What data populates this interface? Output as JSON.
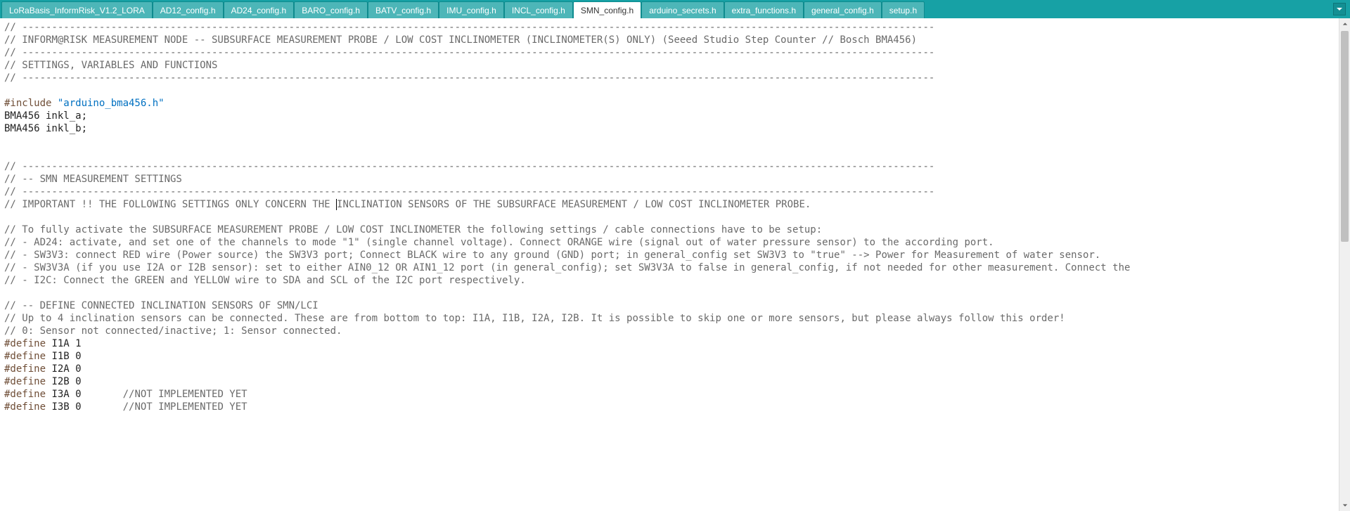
{
  "tabs": [
    {
      "label": "LoRaBasis_InformRisk_V1.2_LORA"
    },
    {
      "label": "AD12_config.h"
    },
    {
      "label": "AD24_config.h"
    },
    {
      "label": "BARO_config.h"
    },
    {
      "label": "BATV_config.h"
    },
    {
      "label": "IMU_config.h"
    },
    {
      "label": "INCL_config.h"
    },
    {
      "label": "SMN_config.h"
    },
    {
      "label": "arduino_secrets.h"
    },
    {
      "label": "extra_functions.h"
    },
    {
      "label": "general_config.h"
    },
    {
      "label": "setup.h"
    }
  ],
  "active_tab_index": 7,
  "icons": {
    "dropdown": "chevron-down-icon",
    "scroll_up": "scroll-up-icon",
    "scroll_down": "scroll-down-icon"
  },
  "code": {
    "l1": "// ----------------------------------------------------------------------------------------------------------------------------------------------------------",
    "l2": "// INFORM@RISK MEASUREMENT NODE -- SUBSURFACE MEASUREMENT PROBE / LOW COST INCLINOMETER (INCLINOMETER(S) ONLY) (Seeed Studio Step Counter // Bosch BMA456)",
    "l3": "// ----------------------------------------------------------------------------------------------------------------------------------------------------------",
    "l4": "// SETTINGS, VARIABLES AND FUNCTIONS",
    "l5": "// ----------------------------------------------------------------------------------------------------------------------------------------------------------",
    "l6_include": "#include ",
    "l6_string": "\"arduino_bma456.h\"",
    "l7": "BMA456 inkl_a;",
    "l8": "BMA456 inkl_b;",
    "l9": "// ----------------------------------------------------------------------------------------------------------------------------------------------------------",
    "l10": "// -- SMN MEASUREMENT SETTINGS",
    "l11": "// ----------------------------------------------------------------------------------------------------------------------------------------------------------",
    "l12a": "// IMPORTANT !! THE FOLLOWING SETTINGS ONLY CONCERN THE ",
    "l12b": "INCLINATION SENSORS OF THE SUBSURFACE MEASUREMENT / LOW COST INCLINOMETER PROBE.",
    "l13": "// To fully activate the SUBSURFACE MEASUREMENT PROBE / LOW COST INCLINOMETER the following settings / cable connections have to be setup:",
    "l14": "// - AD24: activate, and set one of the channels to mode \"1\" (single channel voltage). Connect ORANGE wire (signal out of water pressure sensor) to the according port.",
    "l15": "// - SW3V3: connect RED wire (Power source) the SW3V3 port; Connect BLACK wire to any ground (GND) port; in general_config set SW3V3 to \"true\" --> Power for Measurement of water sensor.",
    "l16": "// - SW3V3A (if you use I2A or I2B sensor): set to either AIN0_12 OR AIN1_12 port (in general_config); set SW3V3A to false in general_config, if not needed for other measurement. Connect the",
    "l17": "// - I2C: Connect the GREEN and YELLOW wire to SDA and SCL of the I2C port respectively.",
    "l18": "// -- DEFINE CONNECTED INCLINATION SENSORS OF SMN/LCI",
    "l19": "// Up to 4 inclination sensors can be connected. These are from bottom to top: I1A, I1B, I2A, I2B. It is possible to skip one or more sensors, but please always follow this order!",
    "l20": "// 0: Sensor not connected/inactive; 1: Sensor connected.",
    "d1_def": "#define",
    "d1_rest": " I1A 1",
    "d2_def": "#define",
    "d2_rest": " I1B 0",
    "d3_def": "#define",
    "d3_rest": " I2A 0",
    "d4_def": "#define",
    "d4_rest": " I2B 0",
    "d5_def": "#define",
    "d5_rest": " I3A 0       ",
    "d5_comment": "//NOT IMPLEMENTED YET",
    "d6_def": "#define",
    "d6_rest": " I3B 0       ",
    "d6_comment": "//NOT IMPLEMENTED YET"
  }
}
